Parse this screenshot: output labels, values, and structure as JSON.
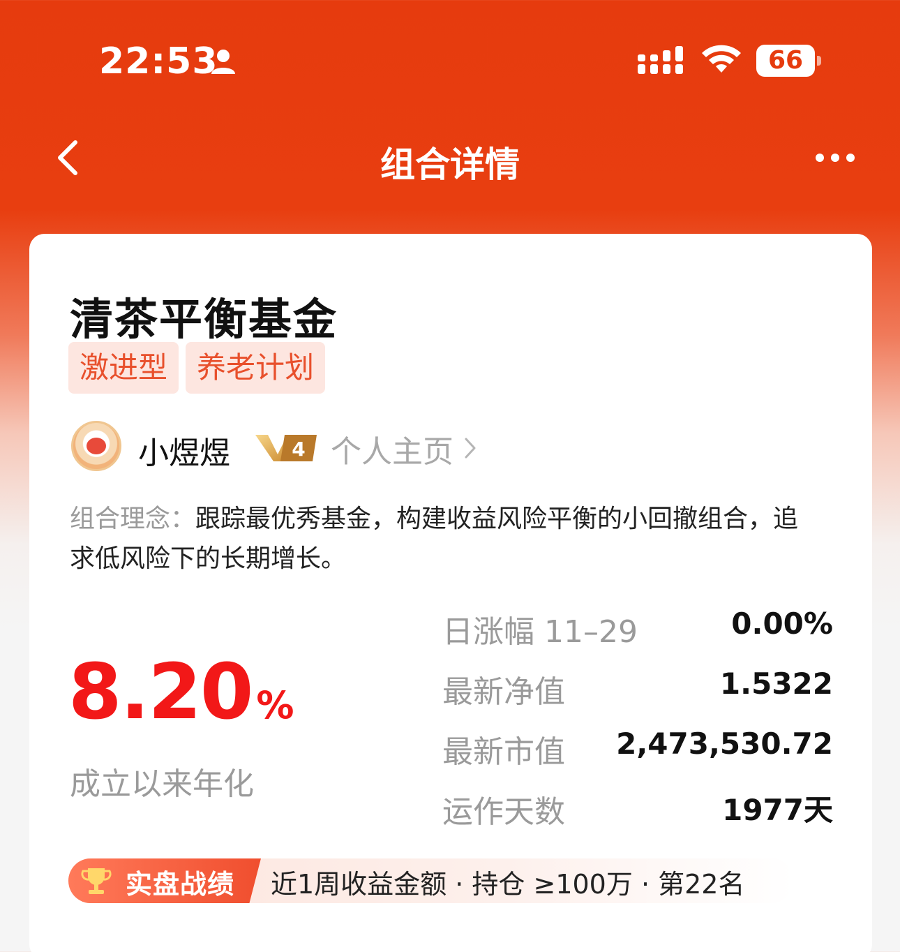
{
  "status_bar": {
    "time": "22:53",
    "battery": "66"
  },
  "nav": {
    "title": "组合详情"
  },
  "fund": {
    "name": "清茶平衡基金",
    "tags": [
      "激进型",
      "养老计划"
    ],
    "author": {
      "name": "小煜煜",
      "level": "4",
      "homepage_label": "个人主页"
    },
    "concept_label": "组合理念：",
    "concept_text": "跟踪最优秀基金，构建收益风险平衡的小回撤组合，追求低风险下的长期增长。",
    "annualized_rate": "8.20",
    "annualized_rate_unit": "%",
    "annualized_label": "成立以来年化",
    "stats": [
      {
        "label": "日涨幅 11–29",
        "value": "0.00%"
      },
      {
        "label": "最新净值",
        "value": "1.5322"
      },
      {
        "label": "最新市值",
        "value": "2,473,530.72"
      },
      {
        "label": "运作天数",
        "value": "1977天"
      }
    ],
    "achievement": {
      "badge": "实盘战绩",
      "text": "近1周收益金额 · 持仓 ≥100万 · 第22名"
    }
  },
  "colors": {
    "brand": "#e63b0e",
    "rise": "#f21818",
    "tag_text": "#e8502c",
    "tag_bg": "#fde6e0"
  }
}
